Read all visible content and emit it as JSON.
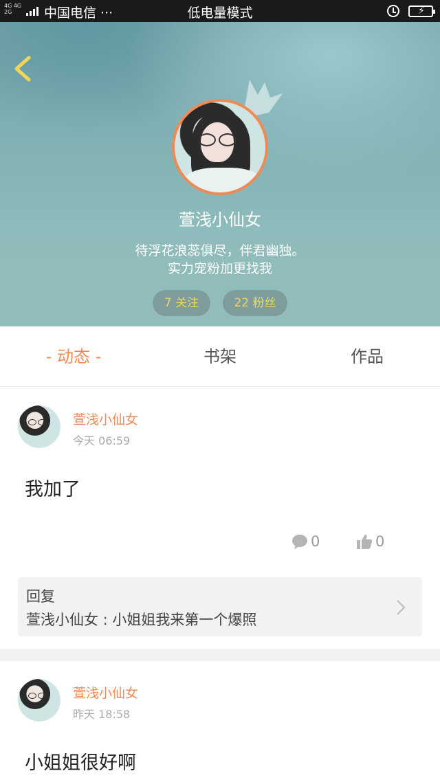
{
  "status_bar": {
    "network_types": "4G 4G\n2G",
    "carrier": "中国电信 ···",
    "mode": "低电量模式"
  },
  "profile": {
    "nickname": "萱浅小仙女",
    "bio_line1": "待浮花浪蕊俱尽，伴君幽独。",
    "bio_line2": "实力宠粉加更找我",
    "follow_label": "7 关注",
    "fans_label": "22 粉丝",
    "accent_color": "#f08a55",
    "pill_text_color": "#f2d65a"
  },
  "tabs": [
    {
      "label": "- 动态 -",
      "active": true
    },
    {
      "label": "书架",
      "active": false
    },
    {
      "label": "作品",
      "active": false
    }
  ],
  "posts": [
    {
      "author": "萱浅小仙女",
      "time": "今天 06:59",
      "text": "我加了",
      "comments": "0",
      "likes": "0",
      "reply": {
        "title": "回复",
        "line": "萱浅小仙女 : 小姐姐我来第一个爆照"
      }
    },
    {
      "author": "萱浅小仙女",
      "time": "昨天 18:58",
      "text": "小姐姐很好啊"
    }
  ],
  "icons": {
    "back": "back-arrow-icon",
    "alarm": "alarm-icon",
    "battery": "battery-charging-icon",
    "comment": "comment-bubble-icon",
    "like": "thumbs-up-icon",
    "chevron": "chevron-right-icon",
    "crown": "crown-icon"
  }
}
